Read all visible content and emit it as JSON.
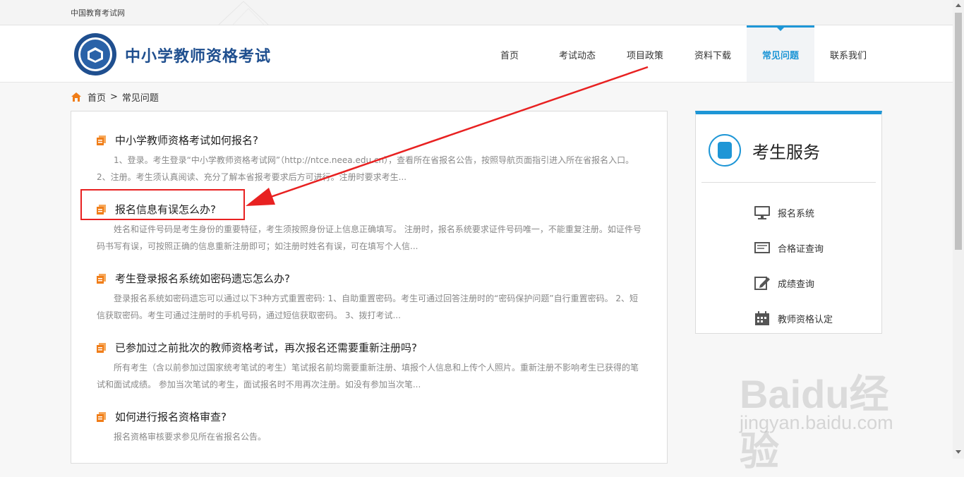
{
  "topbar": {
    "site_name": "中国教育考试网"
  },
  "header": {
    "brand": "中小学教师资格考试"
  },
  "nav": [
    {
      "label": "首页",
      "active": false
    },
    {
      "label": "考试动态",
      "active": false
    },
    {
      "label": "项目政策",
      "active": false
    },
    {
      "label": "资料下载",
      "active": false
    },
    {
      "label": "常见问题",
      "active": true
    },
    {
      "label": "联系我们",
      "active": false
    }
  ],
  "breadcrumb": {
    "home": "首页",
    "sep": ">",
    "current": "常见问题"
  },
  "faq": [
    {
      "title": "中小学教师资格考试如何报名?",
      "desc": "1、登录。考生登录“中小学教师资格考试网”（http://ntce.neea.edu.cn），查看所在省报名公告，按照导航页面指引进入所在省报名入口。 2、注册。考生须认真阅读、充分了解本省报考要求后方可进行。注册时要求考生..."
    },
    {
      "title": "报名信息有误怎么办?",
      "desc": "姓名和证件号码是考生身份的重要特征，考生须按照身份证上信息正确填写。 注册时，报名系统要求证件号码唯一，不能重复注册。如证件号码书写有误，可按照正确的信息重新注册即可；如注册时姓名有误，可在填写个人信..."
    },
    {
      "title": "考生登录报名系统如密码遗忘怎么办?",
      "desc": "登录报名系统如密码遗忘可以通过以下3种方式重置密码: 1、自助重置密码。考生可通过回答注册时的“密码保护问题”自行重置密码。 2、短信获取密码。考生可通过注册时的手机号码，通过短信获取密码。 3、拨打考试..."
    },
    {
      "title": "已参加过之前批次的教师资格考试，再次报名还需要重新注册吗?",
      "desc": "所有考生（含以前参加过国家统考笔试的考生）笔试报名前均需要重新注册、填报个人信息和上传个人照片。重新注册不影响考生已获得的笔试和面试成绩。 参加当次笔试的考生，面试报名时不用再次注册。如没有参加当次笔..."
    },
    {
      "title": "如何进行报名资格审查?",
      "desc": "报名资格审核要求参见所在省报名公告。"
    }
  ],
  "sidebar": {
    "title": "考生服务",
    "items": [
      {
        "label": "报名系统",
        "icon": "monitor-icon"
      },
      {
        "label": "合格证查询",
        "icon": "card-icon"
      },
      {
        "label": "成绩查询",
        "icon": "edit-icon"
      },
      {
        "label": "教师资格认定",
        "icon": "calendar-icon"
      }
    ]
  },
  "watermark": {
    "brand": "Baidu经验",
    "url": "jingyan.baidu.com"
  },
  "colors": {
    "accent": "#1e96d6",
    "brand": "#1f4f8f",
    "annotation": "#e82121",
    "faq_icon": "#f07d18"
  }
}
